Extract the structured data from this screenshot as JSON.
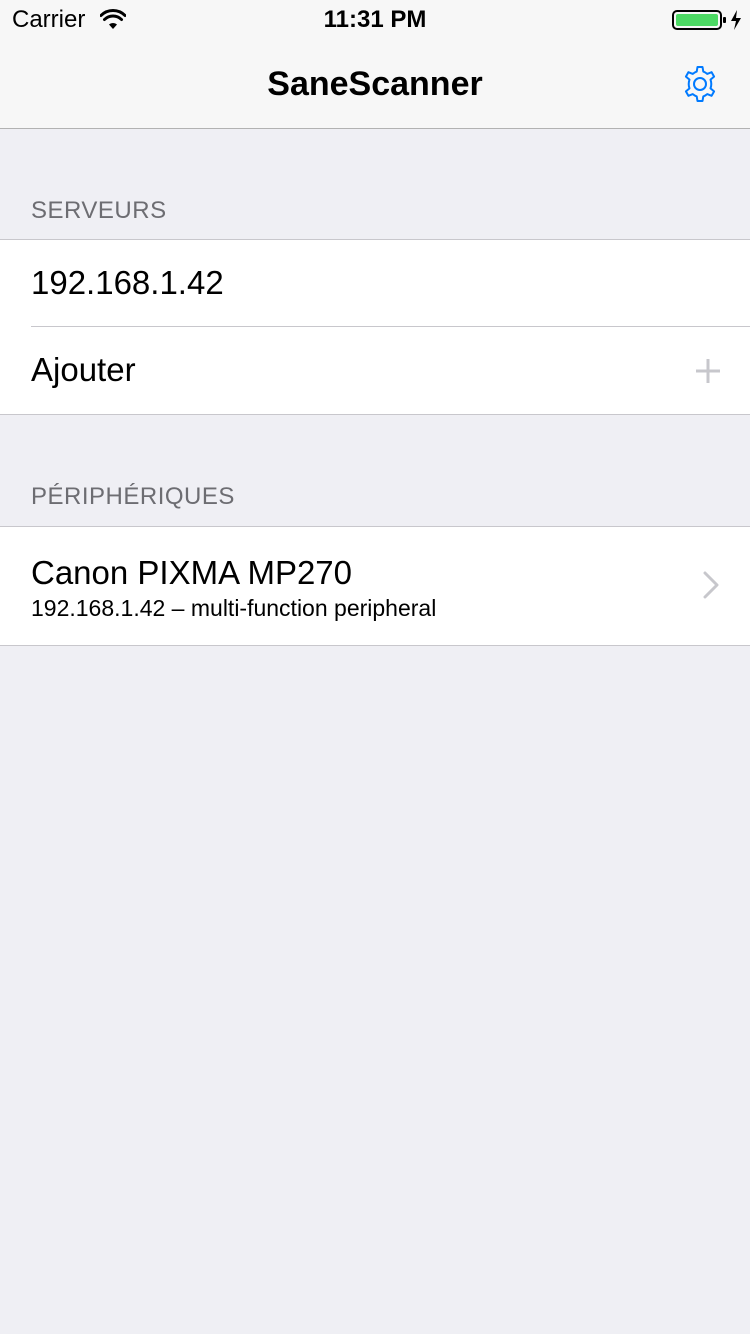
{
  "status_bar": {
    "carrier": "Carrier",
    "time": "11:31 PM",
    "battery_color": "#4cd964"
  },
  "nav": {
    "title": "SaneScanner",
    "settings_icon": "gear-icon",
    "tint_color": "#007aff"
  },
  "servers_section": {
    "header": "SERVEURS",
    "items": [
      {
        "label": "192.168.1.42"
      }
    ],
    "add_label": "Ajouter",
    "add_icon": "plus-icon"
  },
  "devices_section": {
    "header": "PÉRIPHÉRIQUES",
    "items": [
      {
        "title": "Canon PIXMA MP270",
        "subtitle": "192.168.1.42 – multi-function peripheral",
        "accessory_icon": "chevron-right-icon"
      }
    ]
  }
}
